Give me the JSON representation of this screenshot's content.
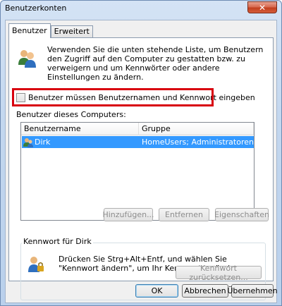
{
  "window": {
    "title": "Benutzerkonten",
    "close_glyph": "✕"
  },
  "tabs": [
    {
      "label": "Benutzer",
      "active": true
    },
    {
      "label": "Erweitert",
      "active": false
    }
  ],
  "description": "Verwenden Sie die unten stehende Liste, um Benutzern den Zugriff auf den Computer zu gestatten bzw. zu verweigern und um Kennwörter oder andere Einstellungen zu ändern.",
  "require_password": {
    "label": "Benutzer müssen Benutzernamen und Kennwort eingeben",
    "checked": false
  },
  "users_section_label": "Benutzer dieses Computers:",
  "users_table": {
    "columns": [
      "Benutzername",
      "Gruppe"
    ],
    "rows": [
      {
        "name": "Dirk",
        "group": "HomeUsers; Administratoren",
        "selected": true
      }
    ]
  },
  "list_buttons": {
    "add": "Hinzufügen...",
    "remove": "Entfernen",
    "properties": "Eigenschaften"
  },
  "password_group": {
    "title": "Kennwort für Dirk",
    "text": "Drücken Sie Strg+Alt+Entf, und wählen Sie \"Kennwort ändern\", um Ihr Kennwort zu ändern.",
    "reset_button": "Kennwort zurücksetzen..."
  },
  "dialog_buttons": {
    "ok": "OK",
    "cancel": "Abbrechen",
    "apply": "Übernehmen"
  },
  "colors": {
    "selection": "#3399ff",
    "highlight": "#d8000e",
    "close": "#c2401f"
  }
}
